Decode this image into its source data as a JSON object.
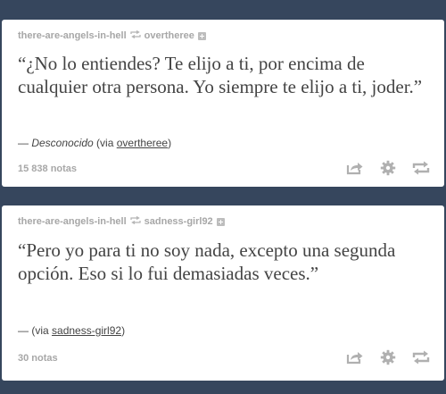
{
  "posts": [
    {
      "blog": "there-are-angels-in-hell",
      "reblogged_from": "overtheree",
      "quote": "“¿No lo entiendes? Te elijo a ti, por encima de cualquier otra persona. Yo siempre te elijo a ti, joder.”",
      "source_prefix": "— ",
      "source_author": "Desconocido",
      "source_via_label": " (via ",
      "source_via": "overtheree",
      "source_suffix": ")",
      "notes": "15 838 notas"
    },
    {
      "blog": "there-are-angels-in-hell",
      "reblogged_from": "sadness-girl92",
      "quote": "“Pero yo para ti no soy nada, excepto una segunda opción. Eso si lo fui demasiadas veces.”",
      "source_prefix": "— ",
      "source_author": "",
      "source_via_label": "(via ",
      "source_via": "sadness-girl92",
      "source_suffix": ")",
      "notes": "30 notas"
    }
  ],
  "icons": {
    "share": "share-icon",
    "settings": "gear-icon",
    "reblog": "reblog-icon",
    "follow": "plus-icon"
  },
  "colors": {
    "background": "#36465d",
    "card": "#ffffff",
    "muted": "#a7a7a7",
    "text": "#444444"
  }
}
